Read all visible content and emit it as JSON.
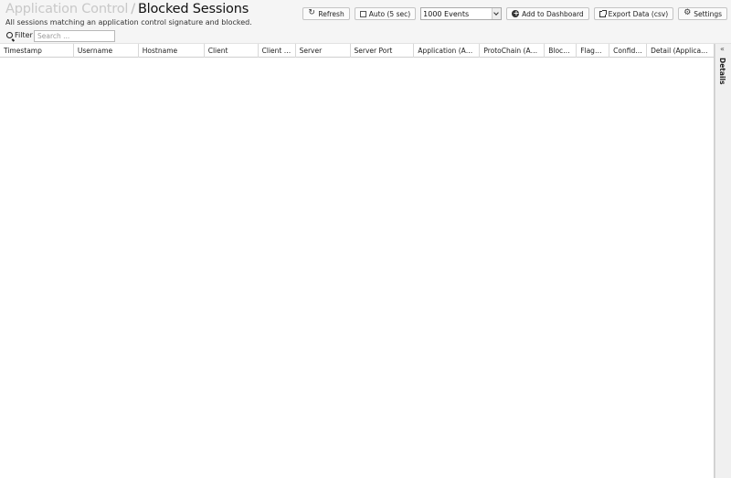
{
  "header": {
    "breadcrumb": "Application Control",
    "separator": "/",
    "title": "Blocked Sessions",
    "subtitle": "All sessions matching an application control signature and blocked."
  },
  "toolbar": {
    "refresh_label": "Refresh",
    "auto_label": "Auto (5 sec)",
    "events_selected": "1000 Events",
    "add_dashboard_label": "Add to Dashboard",
    "export_label": "Export Data (csv)",
    "settings_label": "Settings"
  },
  "filter": {
    "label": "Filter",
    "placeholder": "Search ..."
  },
  "grid": {
    "columns": [
      "Timestamp",
      "Username",
      "Hostname",
      "Client",
      "Client P...",
      "Server",
      "Server Port",
      "Application (Appli...",
      "ProtoChain (Appl...",
      "Block...",
      "Flagg...",
      "Confide...",
      "Detail (Applicatio..."
    ],
    "rows": []
  },
  "details_panel": {
    "label": "Details"
  }
}
